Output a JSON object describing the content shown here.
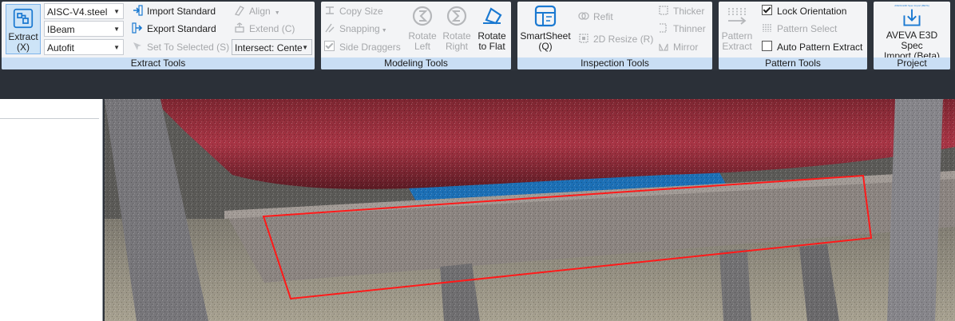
{
  "colors": {
    "ribbon_bg": "#f3f4f6",
    "group_label_bg": "#c9def4",
    "accent_blue": "#1a79d1",
    "selection_red": "#ff1a1a"
  },
  "extract_tools": {
    "extract_button": "Extract",
    "extract_shortcut": "(X)",
    "steel_library": "AISC-V4.steel",
    "shape_type": "IBeam",
    "fit_mode": "Autofit",
    "import_standard": "Import Standard",
    "export_standard": "Export Standard",
    "set_to_selected": "Set To Selected (S)",
    "align": "Align",
    "extend": "Extend (C)",
    "intersect": "Intersect: Cente",
    "group_label": "Extract Tools"
  },
  "modeling_tools": {
    "copy_size": "Copy Size",
    "snapping": "Snapping",
    "side_draggers": "Side Draggers",
    "rotate_left_1": "Rotate",
    "rotate_left_2": "Left",
    "rotate_right_1": "Rotate",
    "rotate_right_2": "Right",
    "rotate_flat_1": "Rotate",
    "rotate_flat_2": "to Flat",
    "group_label": "Modeling Tools"
  },
  "inspection_tools": {
    "smartsheet_1": "SmartSheet",
    "smartsheet_2": "(Q)",
    "refit": "Refit",
    "resize_2d": "2D Resize (R)",
    "thicker": "Thicker",
    "thinner": "Thinner",
    "mirror": "Mirror",
    "group_label": "Inspection Tools"
  },
  "pattern_tools": {
    "pattern_extract_1": "Pattern",
    "pattern_extract_2": "Extract",
    "lock_orientation": "Lock Orientation",
    "pattern_select": "Pattern Select",
    "auto_pattern_extract": "Auto Pattern Extract",
    "group_label": "Pattern Tools"
  },
  "project": {
    "aveva_1": "AVEVA E3D Spec",
    "aveva_2": "Import (Beta)",
    "aveva_icon_text": "AVEVA E3D Spec Import (BETA)",
    "group_label": "Project"
  }
}
